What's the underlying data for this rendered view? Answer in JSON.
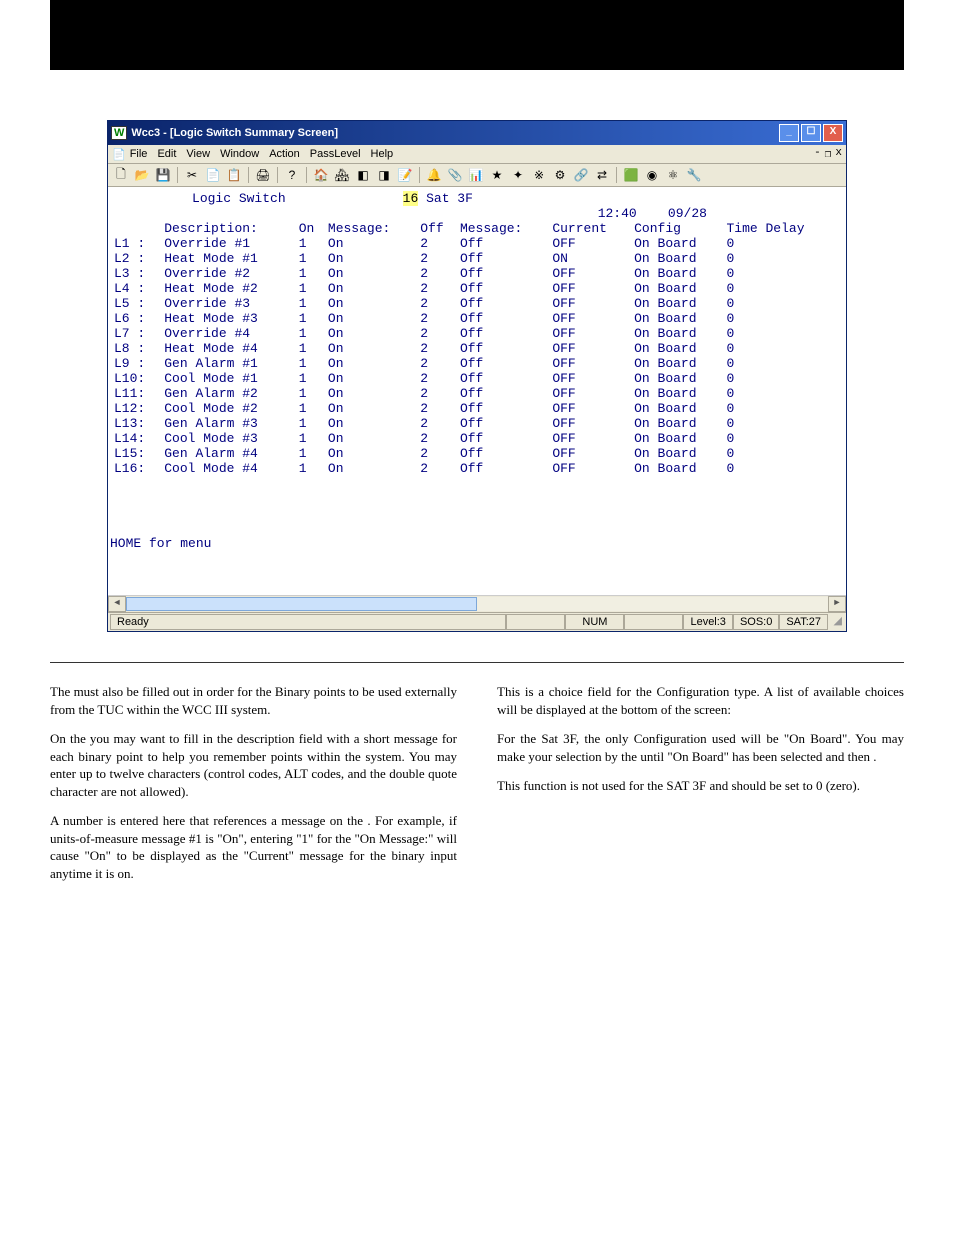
{
  "window": {
    "app_icon": "W",
    "title": "Wcc3 - [Logic Switch Summary Screen]",
    "buttons": {
      "min": "_",
      "max": "☐",
      "close": "X"
    }
  },
  "menubar": {
    "items": [
      "File",
      "Edit",
      "View",
      "Window",
      "Action",
      "PassLevel",
      "Help"
    ],
    "inner": {
      "min": "-",
      "restore": "❐",
      "close": "x"
    }
  },
  "toolbar_icons": [
    "🗋",
    "📂",
    "💾",
    "|",
    "✂",
    "📄",
    "📋",
    "|",
    "🖨",
    "|",
    "?",
    "|",
    "🏠",
    "🏘",
    "◧",
    "◨",
    "📝",
    "|",
    "🔔",
    "📎",
    "📊",
    "★",
    "✦",
    "※",
    "⚙",
    "🔗",
    "⇄",
    "|",
    "🟩",
    "◉",
    "⚛",
    "🔧"
  ],
  "screen": {
    "heading": "Logic Switch",
    "sat_num": "16",
    "sat_label": "Sat 3F",
    "time": "12:40",
    "date": "09/28",
    "col_headers": {
      "desc": "Description:",
      "on": "On",
      "msg": "Message:",
      "off": "Off",
      "msg2": "Message:",
      "current": "Current",
      "config": "Config",
      "tdelay": "Time Delay"
    },
    "rows": [
      {
        "id": "L1 :",
        "desc": "Override #1",
        "on": "1",
        "onm": "On",
        "off": "2",
        "offm": "Off",
        "cur": "OFF",
        "cfg": "On Board",
        "td": "0"
      },
      {
        "id": "L2 :",
        "desc": "Heat Mode #1",
        "on": "1",
        "onm": "On",
        "off": "2",
        "offm": "Off",
        "cur": "ON",
        "cfg": "On Board",
        "td": "0"
      },
      {
        "id": "L3 :",
        "desc": "Override #2",
        "on": "1",
        "onm": "On",
        "off": "2",
        "offm": "Off",
        "cur": "OFF",
        "cfg": "On Board",
        "td": "0"
      },
      {
        "id": "L4 :",
        "desc": "Heat Mode #2",
        "on": "1",
        "onm": "On",
        "off": "2",
        "offm": "Off",
        "cur": "OFF",
        "cfg": "On Board",
        "td": "0"
      },
      {
        "id": "L5 :",
        "desc": "Override #3",
        "on": "1",
        "onm": "On",
        "off": "2",
        "offm": "Off",
        "cur": "OFF",
        "cfg": "On Board",
        "td": "0"
      },
      {
        "id": "L6 :",
        "desc": "Heat Mode #3",
        "on": "1",
        "onm": "On",
        "off": "2",
        "offm": "Off",
        "cur": "OFF",
        "cfg": "On Board",
        "td": "0"
      },
      {
        "id": "L7 :",
        "desc": "Override #4",
        "on": "1",
        "onm": "On",
        "off": "2",
        "offm": "Off",
        "cur": "OFF",
        "cfg": "On Board",
        "td": "0"
      },
      {
        "id": "L8 :",
        "desc": "Heat Mode #4",
        "on": "1",
        "onm": "On",
        "off": "2",
        "offm": "Off",
        "cur": "OFF",
        "cfg": "On Board",
        "td": "0"
      },
      {
        "id": "L9 :",
        "desc": "Gen Alarm #1",
        "on": "1",
        "onm": "On",
        "off": "2",
        "offm": "Off",
        "cur": "OFF",
        "cfg": "On Board",
        "td": "0"
      },
      {
        "id": "L10:",
        "desc": "Cool Mode #1",
        "on": "1",
        "onm": "On",
        "off": "2",
        "offm": "Off",
        "cur": "OFF",
        "cfg": "On Board",
        "td": "0"
      },
      {
        "id": "L11:",
        "desc": "Gen Alarm #2",
        "on": "1",
        "onm": "On",
        "off": "2",
        "offm": "Off",
        "cur": "OFF",
        "cfg": "On Board",
        "td": "0"
      },
      {
        "id": "L12:",
        "desc": "Cool Mode #2",
        "on": "1",
        "onm": "On",
        "off": "2",
        "offm": "Off",
        "cur": "OFF",
        "cfg": "On Board",
        "td": "0"
      },
      {
        "id": "L13:",
        "desc": "Gen Alarm #3",
        "on": "1",
        "onm": "On",
        "off": "2",
        "offm": "Off",
        "cur": "OFF",
        "cfg": "On Board",
        "td": "0"
      },
      {
        "id": "L14:",
        "desc": "Cool Mode #3",
        "on": "1",
        "onm": "On",
        "off": "2",
        "offm": "Off",
        "cur": "OFF",
        "cfg": "On Board",
        "td": "0"
      },
      {
        "id": "L15:",
        "desc": "Gen Alarm #4",
        "on": "1",
        "onm": "On",
        "off": "2",
        "offm": "Off",
        "cur": "OFF",
        "cfg": "On Board",
        "td": "0"
      },
      {
        "id": "L16:",
        "desc": "Cool Mode #4",
        "on": "1",
        "onm": "On",
        "off": "2",
        "offm": "Off",
        "cur": "OFF",
        "cfg": "On Board",
        "td": "0"
      }
    ],
    "footer_hint": "HOME for menu"
  },
  "statusbar": {
    "ready": "Ready",
    "num": "NUM",
    "level": "Level:3",
    "sos": "SOS:0",
    "sat": "SAT:27"
  },
  "doc": {
    "left": {
      "p1": "The must also be filled out in order for the Binary points to be used externally from the TUC within the WCC III system.",
      "p2": "On the you may want to fill in the description field with a short message for each binary point to help you remember points within the system. You may enter up to twelve characters (control codes, ALT codes, and the double quote character are not allowed).",
      "p3": "A number is entered here that references a message on the . For example, if units-of-measure message #1 is \"On\", entering \"1\" for the \"On Message:\" will cause \"On\" to be displayed as the \"Current\" message for the binary input anytime it is on."
    },
    "right": {
      "p1": "This is a choice field for the Configuration type. A list of available choices will be displayed at the bottom of the screen:",
      "p2": "For the Sat 3F, the only Configuration used will be \"On Board\". You may make your selection by the until \"On Board\" has been selected and then .",
      "p3": "This function is not used for the SAT 3F and should be set to 0 (zero)."
    }
  }
}
